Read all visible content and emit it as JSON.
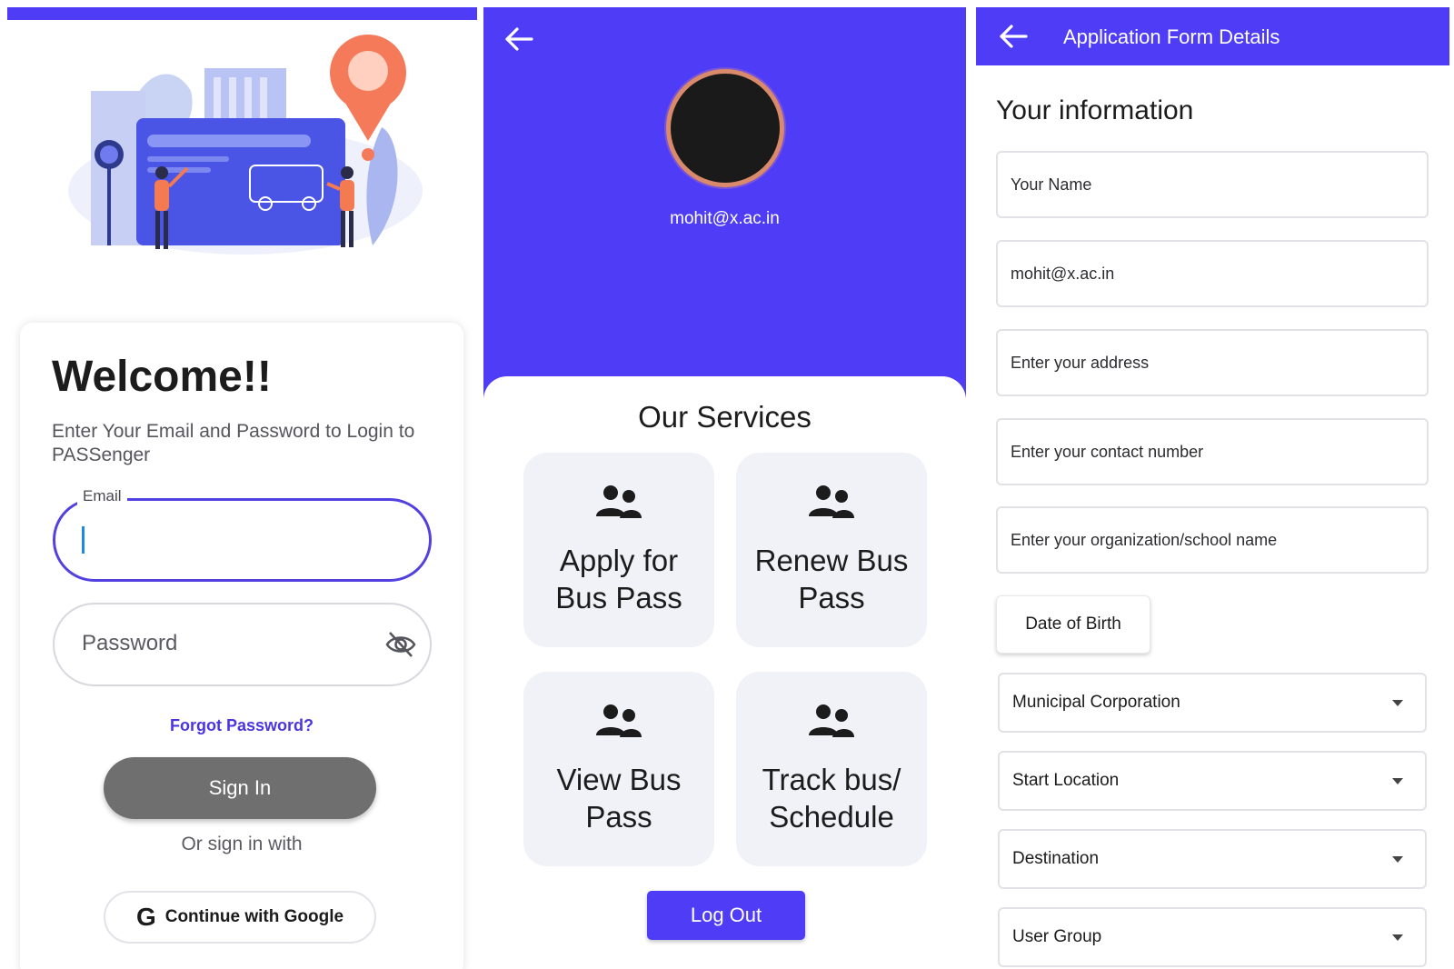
{
  "login": {
    "welcome": "Welcome!!",
    "subtitle": "Enter Your Email and Password to Login to PASSenger",
    "email_label": "Email",
    "email_value": "",
    "password_placeholder": "Password",
    "forgot": "Forgot Password?",
    "signin": "Sign In",
    "or_text": "Or sign in with",
    "google_letter": "G",
    "google": "Continue with Google",
    "accent": "#4f3cf7"
  },
  "services": {
    "email": "mohit@x.ac.in",
    "title": "Our Services",
    "tiles": [
      {
        "label": "Apply for Bus Pass",
        "icon": "people-icon"
      },
      {
        "label": "Renew Bus Pass",
        "icon": "people-icon"
      },
      {
        "label": "View Bus Pass",
        "icon": "people-icon"
      },
      {
        "label": "Track bus/ Schedule",
        "icon": "people-icon"
      }
    ],
    "logout": "Log Out"
  },
  "form": {
    "title": "Application Form Details",
    "heading": "Your information",
    "fields": [
      "Your Name",
      "mohit@x.ac.in",
      "Enter your address",
      "Enter your contact number",
      "Enter your organization/school name"
    ],
    "dob": "Date of Birth",
    "dropdowns": [
      "Municipal Corporation",
      "Start Location",
      "Destination",
      "User Group"
    ]
  }
}
